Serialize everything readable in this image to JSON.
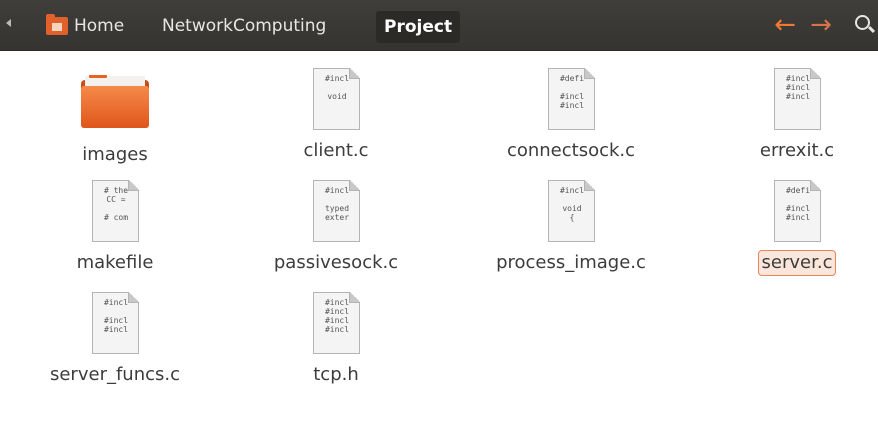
{
  "toolbar": {
    "breadcrumbs": [
      {
        "label": "Home",
        "icon": "home-folder-icon"
      },
      {
        "label": "NetworkComputing"
      },
      {
        "label": "Project",
        "active": true
      }
    ],
    "accent_color": "#f07a35",
    "back_icon": "arrow-left-icon",
    "forward_icon": "arrow-right-icon",
    "search_icon": "search-icon"
  },
  "files": [
    {
      "name": "images",
      "type": "folder"
    },
    {
      "name": "client.c",
      "type": "doc",
      "preview": "#incl\n\nvoid"
    },
    {
      "name": "connectsock.c",
      "type": "doc",
      "preview": "#defi\n\n#incl\n#incl"
    },
    {
      "name": "errexit.c",
      "type": "doc",
      "preview": "#incl\n#incl\n#incl"
    },
    {
      "name": "makefile",
      "type": "doc",
      "preview": "# the\nCC =\n\n# com"
    },
    {
      "name": "passivesock.c",
      "type": "doc",
      "preview": "#incl\n\ntyped\nexter"
    },
    {
      "name": "process_image.c",
      "type": "doc",
      "preview": "#incl\n\nvoid\n{"
    },
    {
      "name": "server.c",
      "type": "doc",
      "preview": "#defi\n\n#incl\n#incl",
      "selected": true
    },
    {
      "name": "server_funcs.c",
      "type": "doc",
      "preview": "#incl\n\n#incl\n#incl"
    },
    {
      "name": "tcp.h",
      "type": "doc",
      "preview": "#incl\n#incl\n#incl\n#incl"
    }
  ]
}
